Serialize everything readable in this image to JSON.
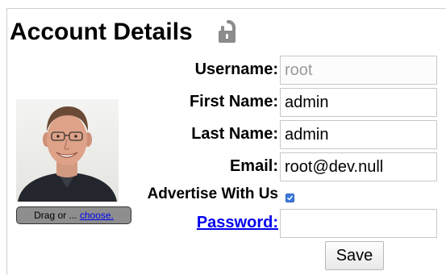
{
  "page": {
    "title": "Account Details",
    "lock_icon": "unlocked-padlock-icon"
  },
  "avatar": {
    "icon": "user-photo",
    "drag_text": "Drag or ... ",
    "choose_link": "choose."
  },
  "form": {
    "username_label": "Username:",
    "username_value": "root",
    "first_name_label": "First Name:",
    "first_name_value": "admin",
    "last_name_label": "Last Name:",
    "last_name_value": "admin",
    "email_label": "Email:",
    "email_value": "root@dev.null",
    "advertise_label": "Advertise With Us",
    "advertise_checked": true,
    "password_label": "Password:",
    "password_value": "",
    "save_label": "Save"
  },
  "colors": {
    "link": "#0000ee",
    "checkbox": "#3a7be0",
    "drag_box_bg": "#8e8e8e",
    "disabled_text": "#9a9a9a"
  }
}
